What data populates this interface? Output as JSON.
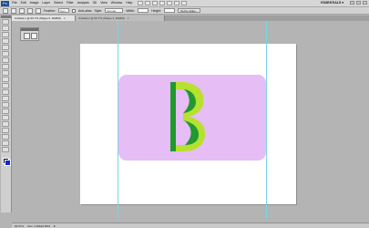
{
  "app": {
    "logo_text": "Ps",
    "menu": [
      "File",
      "Edit",
      "Image",
      "Layer",
      "Select",
      "Filter",
      "Analysis",
      "3D",
      "View",
      "Window",
      "Help"
    ],
    "workspace": "ESSENTIALS ▾"
  },
  "options": {
    "feather_label": "Feather:",
    "feather_value": "0 px",
    "antialias_label": "Anti-alias",
    "style_label": "Style:",
    "style_value": "Normal",
    "width_label": "Width:",
    "height_label": "Height:",
    "refine_label": "Refine Edge..."
  },
  "tabs": [
    {
      "label": "Untitled-1 @ 66.7% (Shape 6, RGB/8)",
      "active": true
    },
    {
      "label": "Untitled-2 @ 66.7% (Shape 3, RGB/8)",
      "active": false
    }
  ],
  "status": {
    "zoom": "66.67%",
    "doc": "Doc: 2.64M/4.50M"
  },
  "colors": {
    "canvas_bg": "#b4b4b4",
    "card": "#e6bdf5",
    "glyph_light": "#b7e12d",
    "glyph_dark": "#1f9a2c",
    "guide": "#77d8e6",
    "foreground": "#000000",
    "background": "#1525d8"
  }
}
